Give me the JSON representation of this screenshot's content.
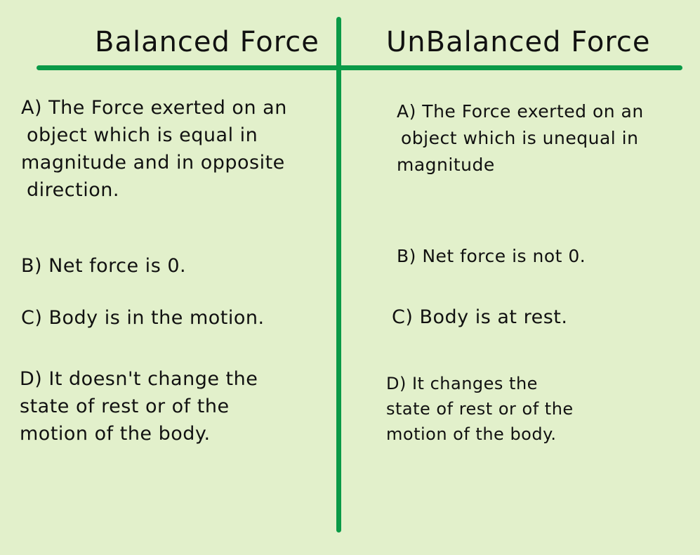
{
  "columns": [
    {
      "heading": "Balanced Force",
      "items": [
        {
          "lines": [
            "A) The Force exerted on an",
            " object which is equal in",
            "magnitude and in opposite",
            " direction."
          ]
        },
        {
          "lines": [
            "B) Net force is 0."
          ]
        },
        {
          "lines": [
            "C) Body is in the motion."
          ]
        },
        {
          "lines": [
            "D) It doesn't change the",
            "state of rest or of the",
            "motion of the body."
          ]
        }
      ]
    },
    {
      "heading": "UnBalanced Force",
      "items": [
        {
          "lines": [
            "A) The Force exerted on an",
            " object which is unequal in",
            "magnitude"
          ]
        },
        {
          "lines": [
            "B) Net force is not 0."
          ]
        },
        {
          "lines": [
            "C) Body is at rest."
          ]
        },
        {
          "lines": [
            "D) It changes the",
            "state of rest or of the",
            "motion of the body."
          ]
        }
      ]
    }
  ],
  "colors": {
    "background": "#e2f0cb",
    "divider": "#0a9a47",
    "text": "#111111"
  }
}
